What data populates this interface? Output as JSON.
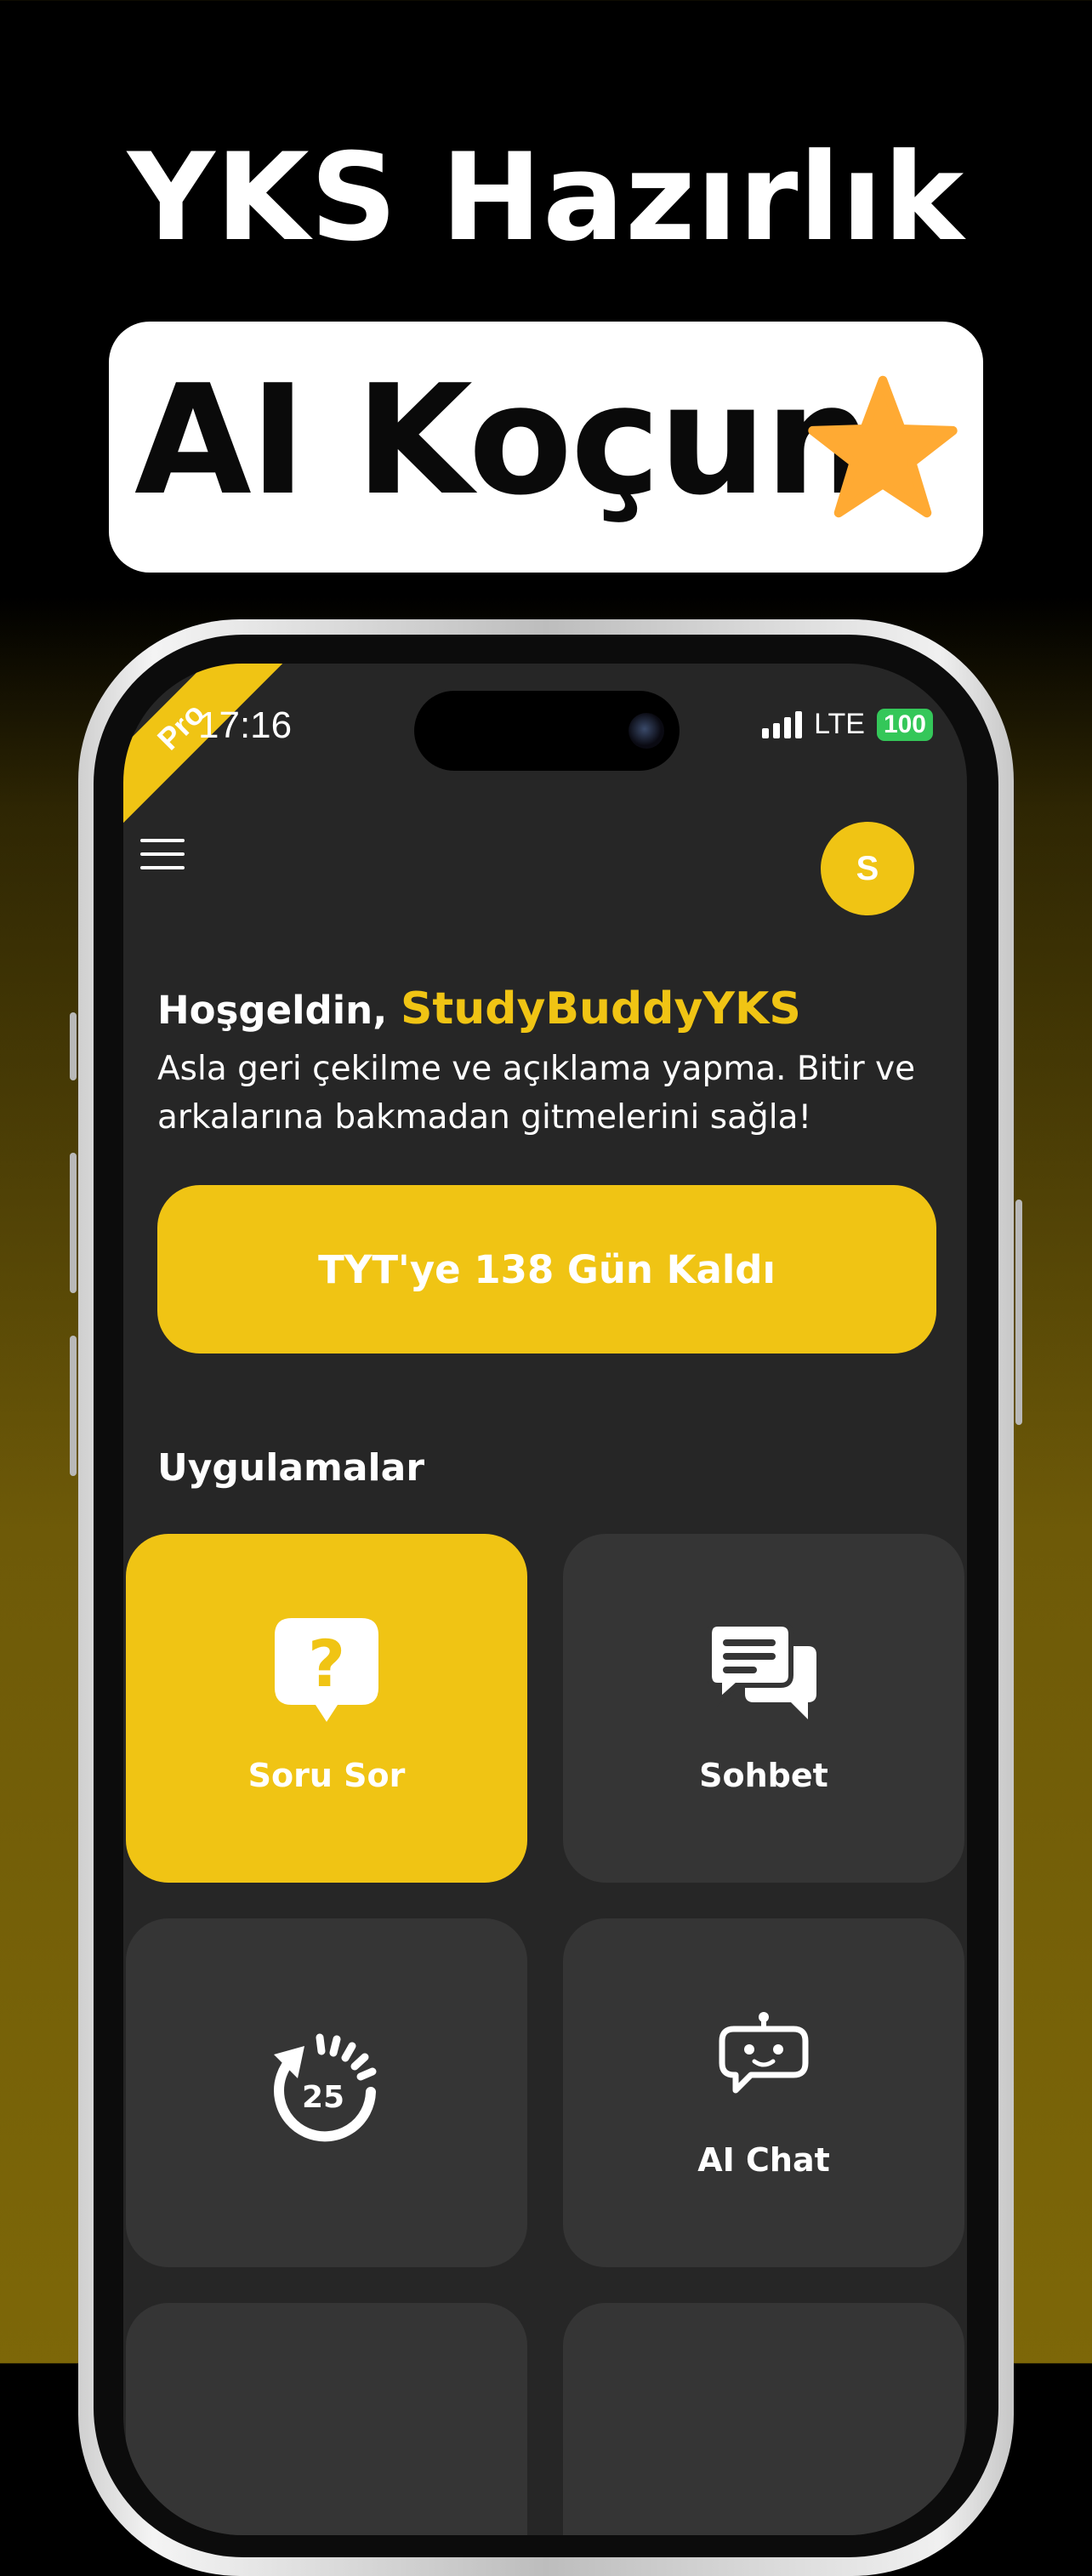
{
  "promo": {
    "headline": "YKS Hazırlık",
    "badge_text": "AI Koçun",
    "star_icon": "star-icon"
  },
  "status_bar": {
    "ribbon": "Pro",
    "time": "17:16",
    "network": "LTE",
    "battery": "100"
  },
  "header": {
    "avatar_initial": "S"
  },
  "welcome": {
    "greeting": "Hoşgeldin, ",
    "username": "StudyBuddyYKS",
    "message": "Asla geri çekilme ve açıklama yapma. Bitir ve arkalarına bakmadan gitmelerini sağla!"
  },
  "countdown": {
    "label": "TYT'ye 138 Gün Kaldı"
  },
  "apps": {
    "title": "Uygulamalar",
    "items": [
      {
        "label": "Soru Sor",
        "icon": "question-bubble-icon",
        "active": true
      },
      {
        "label": "Sohbet",
        "icon": "chat-bubbles-icon",
        "active": false
      },
      {
        "label": "",
        "icon": "timer-25-icon",
        "icon_text": "25",
        "active": false
      },
      {
        "label": "AI Chat",
        "icon": "robot-chat-icon",
        "active": false
      }
    ]
  },
  "colors": {
    "accent": "#f0c414",
    "screen_bg": "#262626",
    "tile_bg": "#353535",
    "battery": "#34c759"
  }
}
